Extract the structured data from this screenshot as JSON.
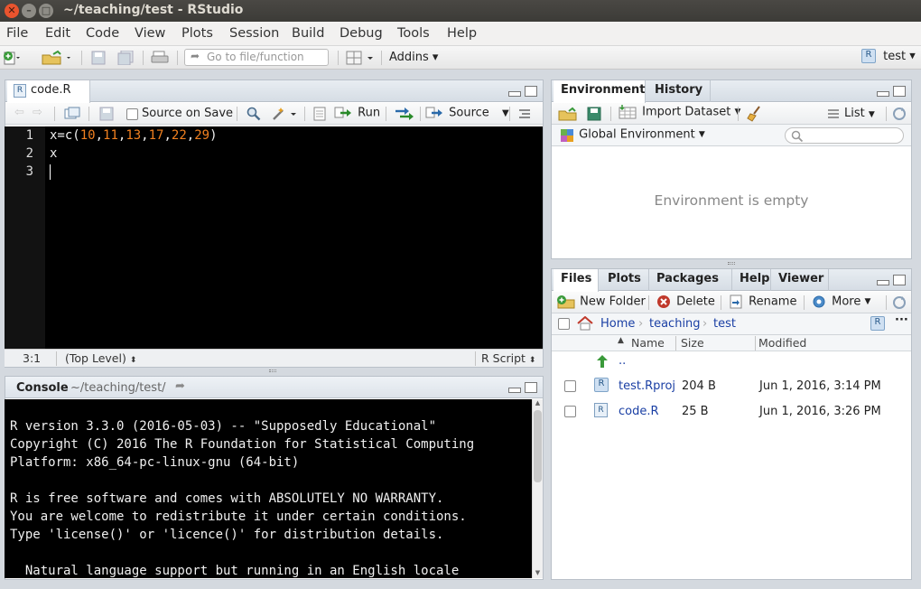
{
  "window": {
    "title": "~/teaching/test - RStudio"
  },
  "menu": [
    "File",
    "Edit",
    "Code",
    "View",
    "Plots",
    "Session",
    "Build",
    "Debug",
    "Tools",
    "Help"
  ],
  "toolbar": {
    "goto_placeholder": "Go to file/function",
    "addins": "Addins",
    "project": "test"
  },
  "editor": {
    "tab": "code.R",
    "source_on_save": "Source on Save",
    "run": "Run",
    "source": "Source",
    "line_numbers": [
      "1",
      "2",
      "3"
    ],
    "line1_prefix": "x=c(",
    "line1_nums": [
      "10",
      "11",
      "13",
      "17",
      "22",
      "29"
    ],
    "line1_suffix": ")",
    "line2": "x",
    "position": "3:1",
    "scope": "(Top Level)",
    "filetype": "R Script"
  },
  "console": {
    "tab": "Console",
    "path": "~/teaching/test/",
    "lines": [
      "R version 3.3.0 (2016-05-03) -- \"Supposedly Educational\"",
      "Copyright (C) 2016 The R Foundation for Statistical Computing",
      "Platform: x86_64-pc-linux-gnu (64-bit)",
      "",
      "R is free software and comes with ABSOLUTELY NO WARRANTY.",
      "You are welcome to redistribute it under certain conditions.",
      "Type 'license()' or 'licence()' for distribution details.",
      "",
      "  Natural language support but running in an English locale"
    ]
  },
  "environment": {
    "tabs": [
      "Environment",
      "History"
    ],
    "import_dataset": "Import Dataset",
    "list": "List",
    "global_env": "Global Environment",
    "empty_message": "Environment is empty"
  },
  "files": {
    "tabs": [
      "Files",
      "Plots",
      "Packages",
      "Help",
      "Viewer"
    ],
    "new_folder": "New Folder",
    "delete": "Delete",
    "rename": "Rename",
    "more": "More",
    "breadcrumb": [
      "Home",
      "teaching",
      "test"
    ],
    "columns": {
      "name": "Name",
      "size": "Size",
      "modified": "Modified"
    },
    "parent": "..",
    "rows": [
      {
        "name": "test.Rproj",
        "size": "204 B",
        "modified": "Jun 1, 2016, 3:14 PM"
      },
      {
        "name": "code.R",
        "size": "25 B",
        "modified": "Jun 1, 2016, 3:26 PM"
      }
    ]
  }
}
